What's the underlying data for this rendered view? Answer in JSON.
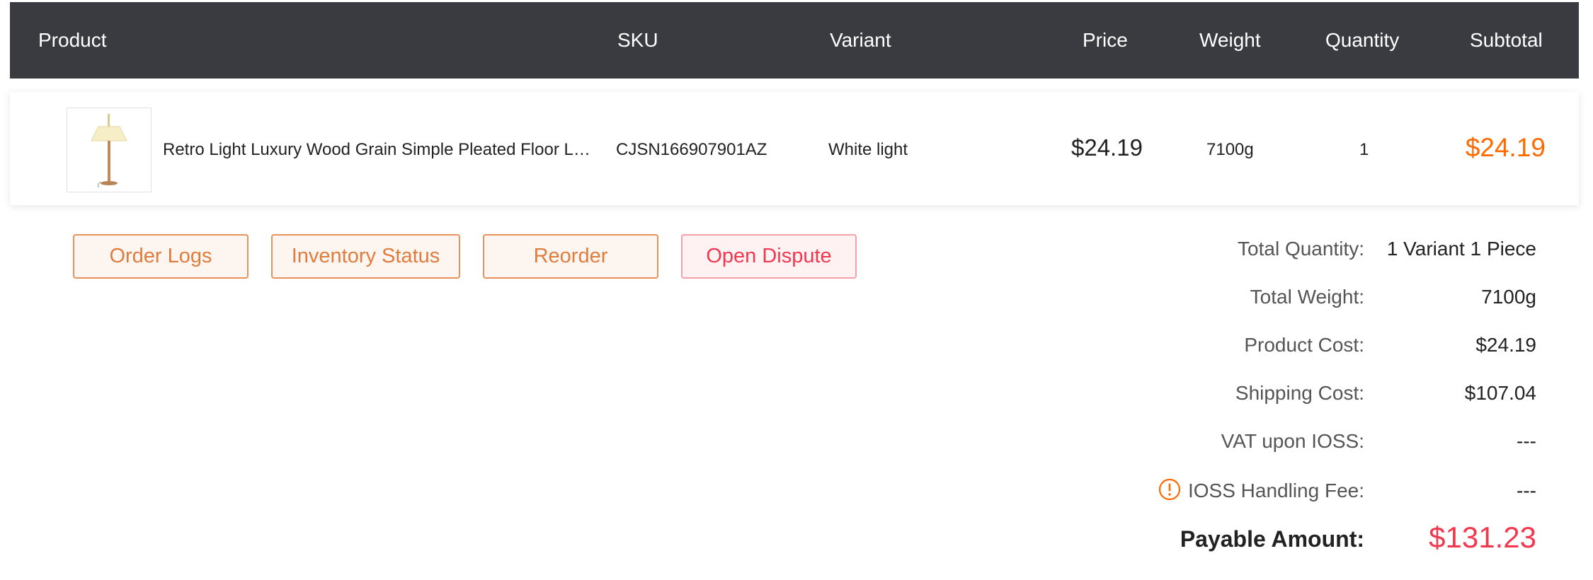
{
  "table": {
    "headers": {
      "product": "Product",
      "sku": "SKU",
      "variant": "Variant",
      "price": "Price",
      "weight": "Weight",
      "quantity": "Quantity",
      "subtotal": "Subtotal"
    },
    "rows": [
      {
        "product_name": "Retro Light Luxury Wood Grain Simple Pleated Floor Lamp",
        "sku": "CJSN166907901AZ",
        "variant": "White light",
        "price": "$24.19",
        "weight": "7100g",
        "quantity": "1",
        "subtotal": "$24.19"
      }
    ]
  },
  "actions": {
    "order_logs": "Order Logs",
    "inventory_status": "Inventory Status",
    "reorder": "Reorder",
    "open_dispute": "Open Dispute"
  },
  "summary": {
    "total_quantity_label": "Total Quantity:",
    "total_quantity_value": "1 Variant 1 Piece",
    "total_weight_label": "Total Weight:",
    "total_weight_value": "7100g",
    "product_cost_label": "Product Cost:",
    "product_cost_value": "$24.19",
    "shipping_cost_label": "Shipping Cost:",
    "shipping_cost_value": "$107.04",
    "vat_label": "VAT upon IOSS:",
    "vat_value": "---",
    "ioss_fee_label": "IOSS Handling Fee:",
    "ioss_fee_value": "---",
    "payable_label": "Payable Amount:",
    "payable_value": "$131.23"
  },
  "icons": {
    "ioss_info": "info-circle-icon",
    "product_thumbnail": "floor-lamp-image"
  },
  "colors": {
    "header_bg": "#3a3b40",
    "accent_orange": "#ff6a00",
    "button_orange": "#e07c3e",
    "danger_red": "#f2384f"
  }
}
